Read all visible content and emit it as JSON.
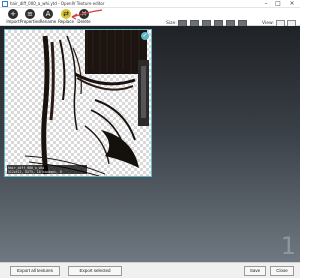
{
  "window": {
    "title": "hair_diff_000_a_whi.ytd - OpenIV Texture editor",
    "min_icon": "minimize-icon",
    "max_icon": "maximize-icon",
    "close_icon": "close-icon"
  },
  "toolbar": {
    "tools": [
      {
        "label": "Import",
        "icon": "import-icon",
        "glyph": "+"
      },
      {
        "label": "Properties",
        "icon": "properties-icon",
        "glyph": "≡"
      },
      {
        "label": "Rename",
        "icon": "rename-icon",
        "glyph": "A"
      },
      {
        "label": "Replace",
        "icon": "replace-icon",
        "glyph": "⇄"
      },
      {
        "label": "Delete",
        "icon": "delete-icon",
        "glyph": "✕"
      }
    ],
    "size_label": "Size:",
    "view_label": "View:"
  },
  "texture": {
    "caption_line1": "hair_diff_000_a_whi",
    "caption_line2": "512x512, DXT5, 10 mipmaps, 0",
    "selected_icon": "checkmark-icon"
  },
  "page_number": "1",
  "footer": {
    "export_all": "Export all textures",
    "export_selected": "Export selected",
    "save": "Save",
    "close": "Close"
  },
  "colors": {
    "accent": "#5fb6c4",
    "replace_highlight": "#d6c431",
    "arrow": "#d23b3b"
  }
}
